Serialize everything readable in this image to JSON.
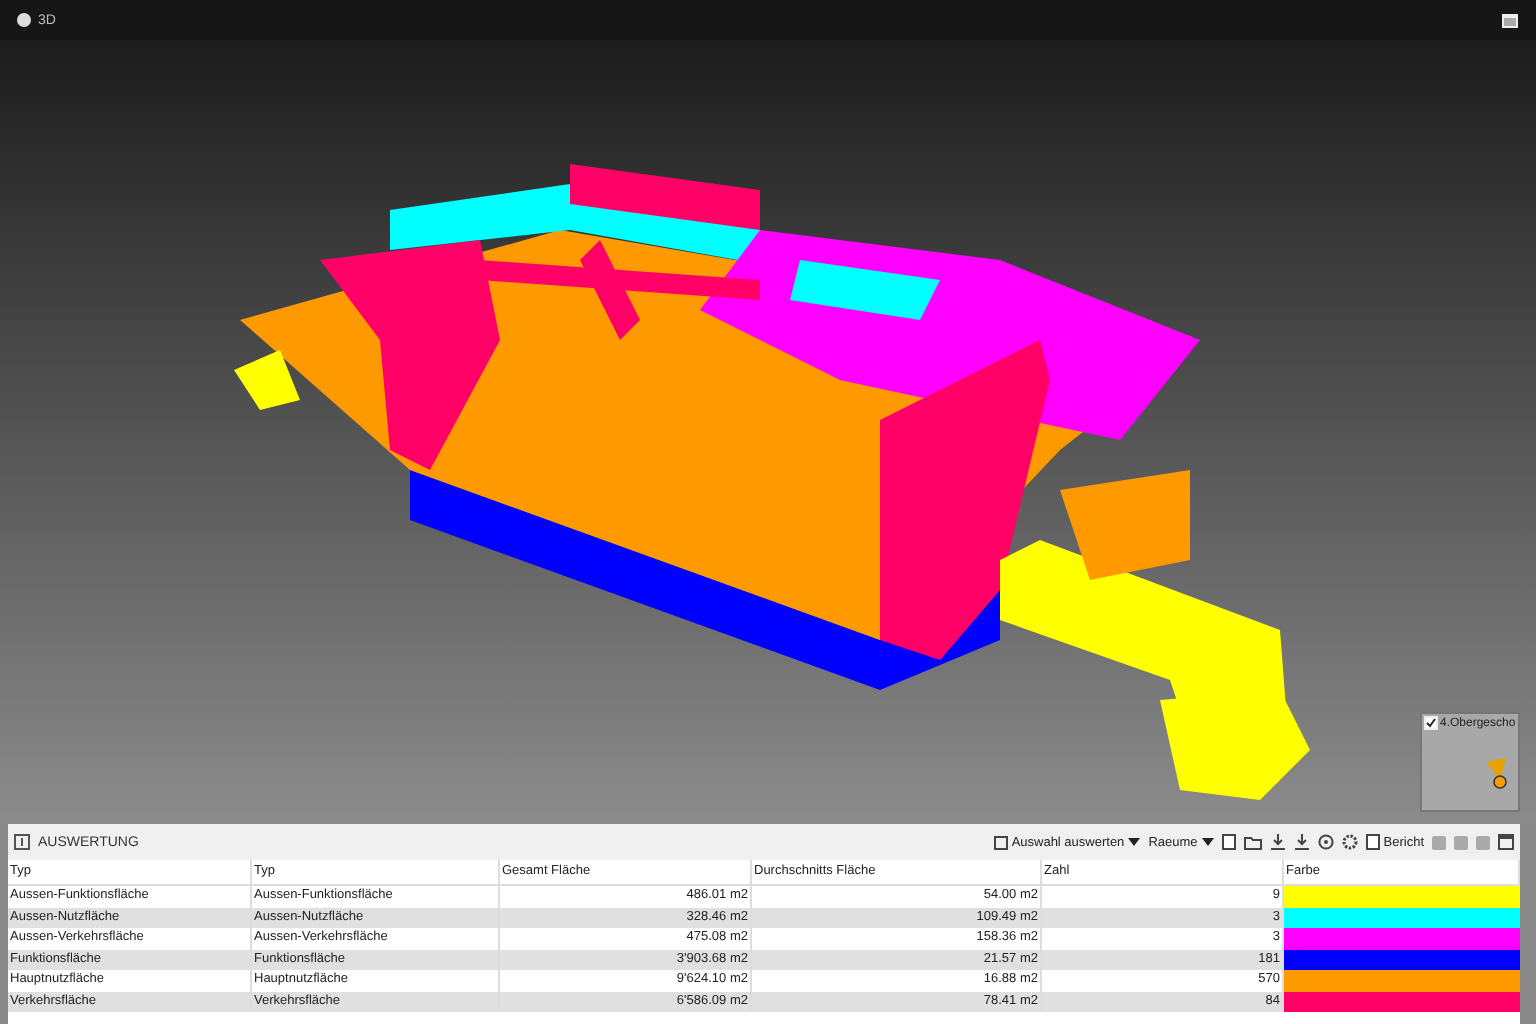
{
  "viewport": {
    "title": "3D",
    "minimap": {
      "label": "4.Obergescho",
      "checked": true
    }
  },
  "panel": {
    "title": "AUSWERTUNG",
    "toolbar": {
      "evaluate": "Auswahl auswerten",
      "rooms": "Raeume",
      "report": "Bericht"
    },
    "table": {
      "columns": [
        "Typ",
        "Typ",
        "Gesamt Fläche",
        "Durchschnitts Fläche",
        "Zahl",
        "Farbe"
      ],
      "rows": [
        {
          "type": "Aussen-Funktionsfläche",
          "type_2": "Aussen-Funktionsfläche",
          "total": "486.01 m2",
          "average": "54.00 m2",
          "count": "9",
          "color": "#ffff00"
        },
        {
          "type": "Aussen-Nutzfläche",
          "type_2": "Aussen-Nutzfläche",
          "total": "328.46 m2",
          "average": "109.49 m2",
          "count": "3",
          "color": "#00ffff"
        },
        {
          "type": "Aussen-Verkehrsfläche",
          "type_2": "Aussen-Verkehrsfläche",
          "total": "475.08 m2",
          "average": "158.36 m2",
          "count": "3",
          "color": "#ff00ff"
        },
        {
          "type": "Funktionsfläche",
          "type_2": "Funktionsfläche",
          "total": "3'903.68 m2",
          "average": "21.57 m2",
          "count": "181",
          "color": "#0000ff"
        },
        {
          "type": "Hauptnutzfläche",
          "type_2": "Hauptnutzfläche",
          "total": "9'624.10 m2",
          "average": "16.88 m2",
          "count": "570",
          "color": "#ff9900"
        },
        {
          "type": "Verkehrsfläche",
          "type_2": "Verkehrsfläche",
          "total": "6'586.09 m2",
          "average": "78.41 m2",
          "count": "84",
          "color": "#ff0066"
        }
      ]
    }
  }
}
